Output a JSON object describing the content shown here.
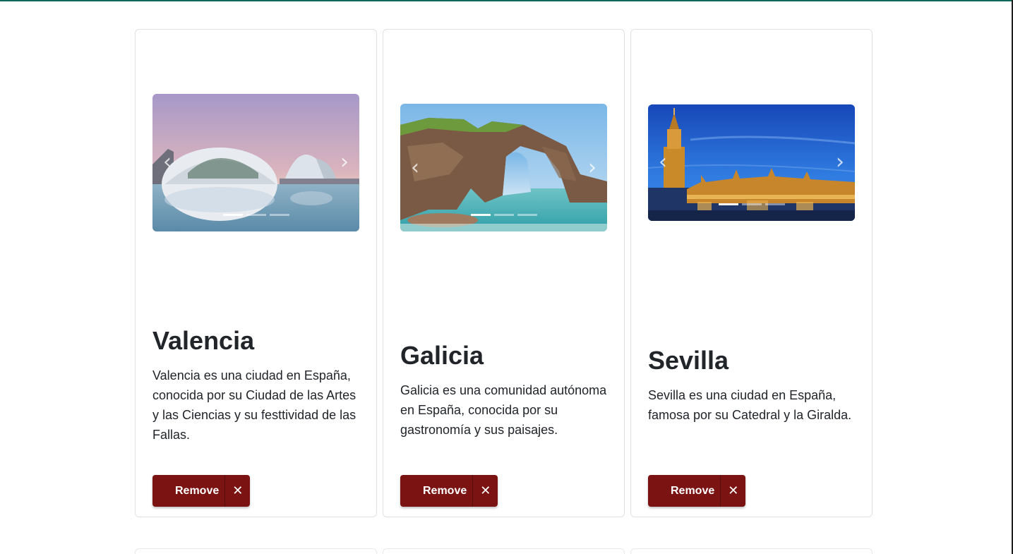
{
  "cards": [
    {
      "title": "Valencia",
      "description": "Valencia es una ciudad en España, conocida por su Ciudad de las Artes y las Ciencias y su festtividad de las Fallas.",
      "remove_label": "Remove",
      "remove_icon": "close-icon",
      "prev_glyph": "‹",
      "next_glyph": "›",
      "close_glyph": "✕",
      "slides_count": 3,
      "active_slide": 1
    },
    {
      "title": "Galicia",
      "description": "Galicia es una comunidad autónoma en España, conocida por su gastronomía y sus paisajes.",
      "remove_label": "Remove",
      "remove_icon": "close-icon",
      "prev_glyph": "‹",
      "next_glyph": "›",
      "close_glyph": "✕",
      "slides_count": 3,
      "active_slide": 1
    },
    {
      "title": "Sevilla",
      "description": "Sevilla es una ciudad en España, famosa por su Catedral y la Giralda.",
      "remove_label": "Remove",
      "remove_icon": "close-icon",
      "prev_glyph": "‹",
      "next_glyph": "›",
      "close_glyph": "✕",
      "slides_count": 3,
      "active_slide": 1
    }
  ],
  "colors": {
    "top_bar": "#0e6a5f",
    "button": "#7b1313",
    "card_border": "#dfe2e5"
  }
}
